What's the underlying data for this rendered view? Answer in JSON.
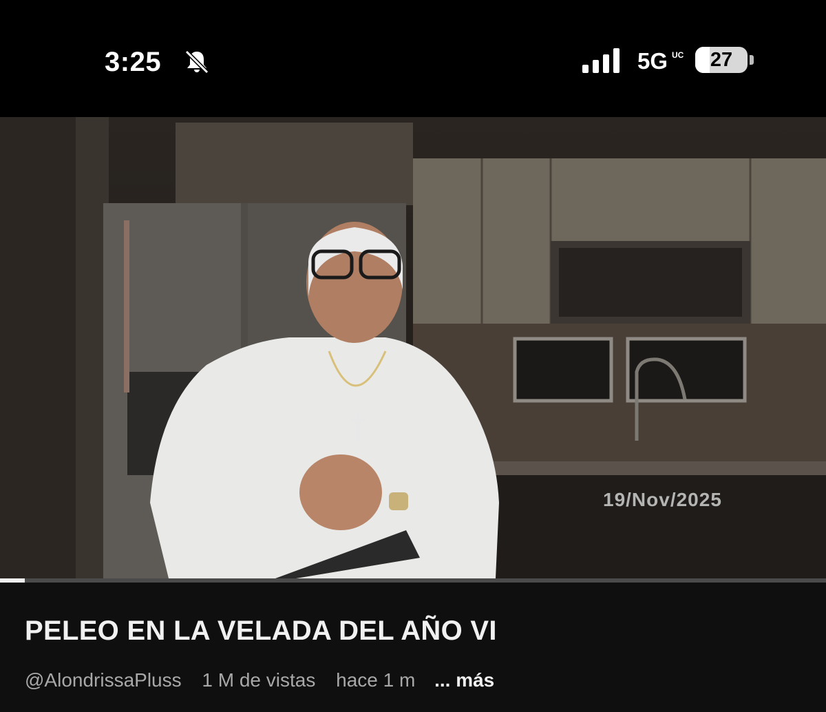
{
  "status_bar": {
    "time": "3:25",
    "network": "5G",
    "network_sub": "UC",
    "battery": "27",
    "icons": [
      "bell-off-icon",
      "cellular-signal-icon",
      "battery-icon"
    ]
  },
  "video": {
    "date_overlay": "19/Nov/2025",
    "progress_percent": 3
  },
  "info": {
    "title": "PELEO EN LA VELADA DEL AÑO VI",
    "channel": "@AlondrissaPluss",
    "views": "1 M de vistas",
    "ago": "hace 1 m",
    "more": "... más"
  },
  "colors": {
    "background": "#0f0f0f",
    "status_bar": "#000000",
    "meta_text": "#a8a8a8"
  }
}
